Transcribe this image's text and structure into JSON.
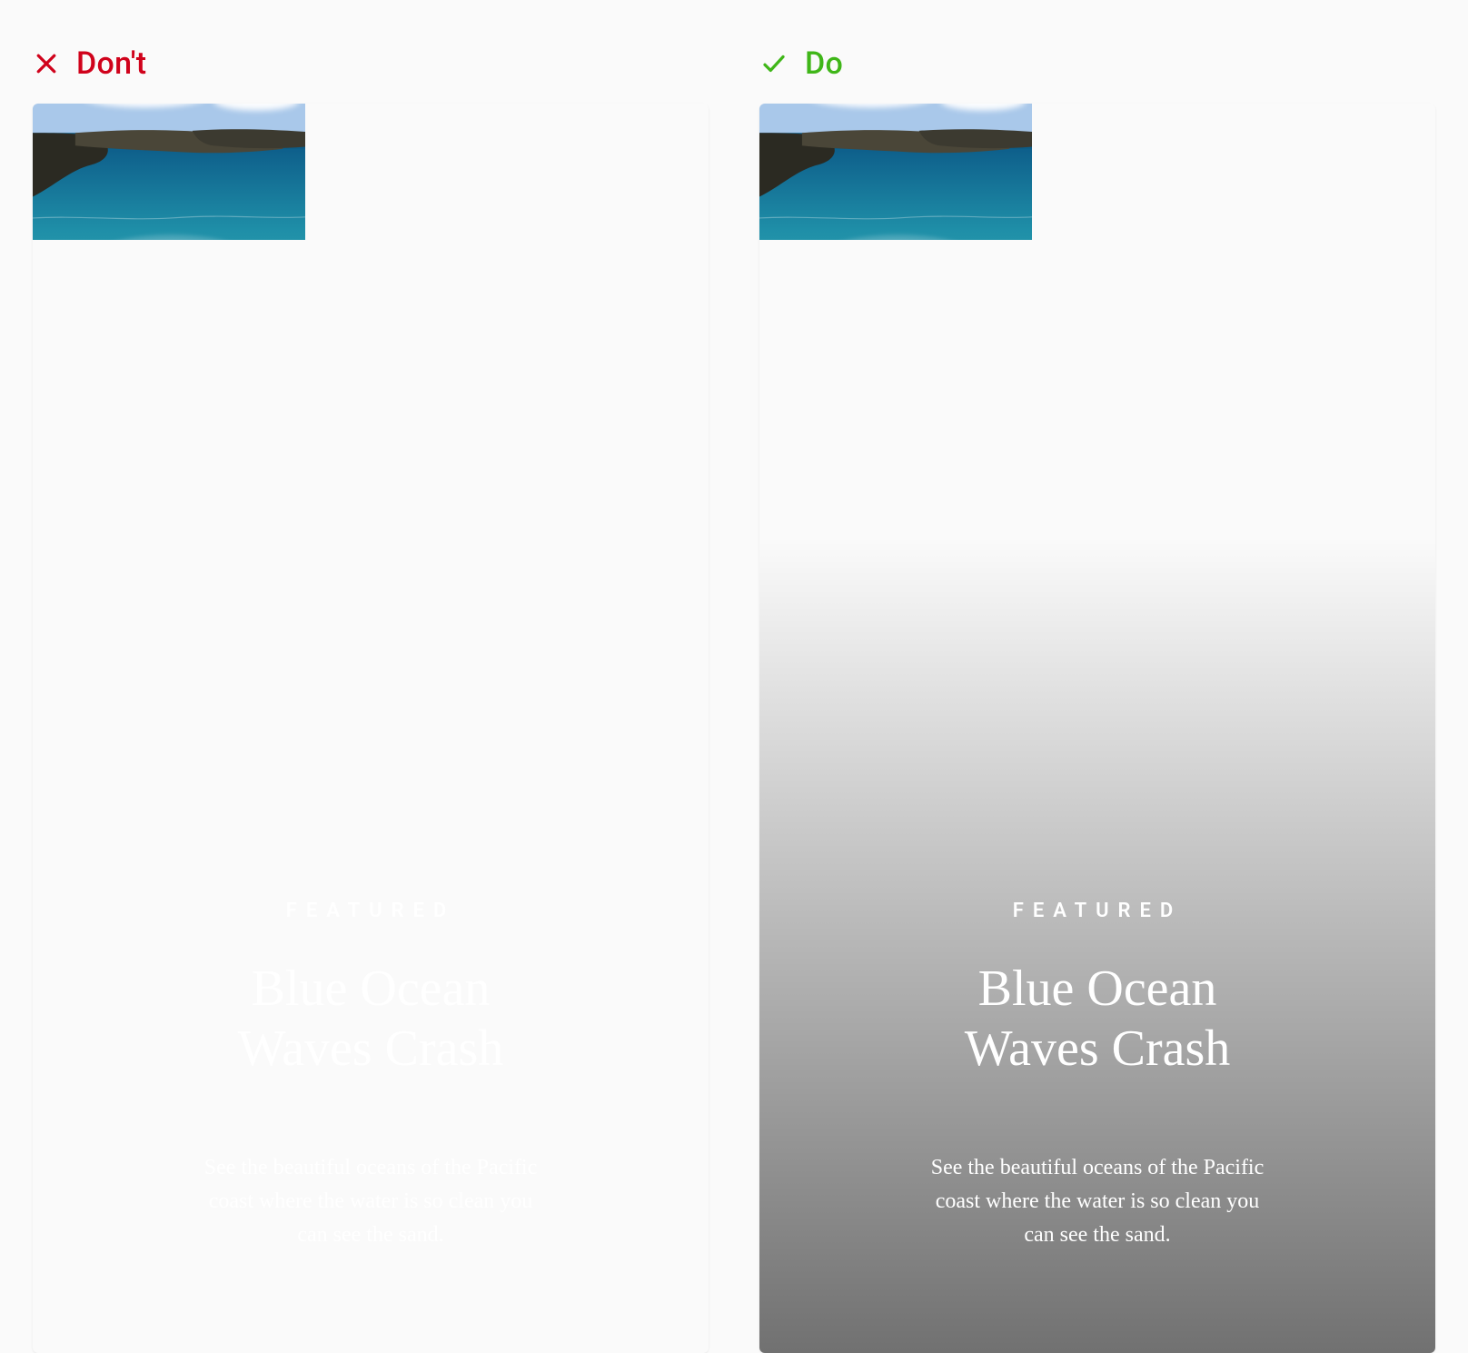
{
  "dont": {
    "label": "Don't",
    "card": {
      "eyebrow": "FEATURED",
      "title": "Blue Ocean Waves Crash",
      "description": "See the beautiful oceans of the Pacific coast where the water is so clean you can see the sand.",
      "has_contrast_overlay": false
    }
  },
  "do": {
    "label": "Do",
    "card": {
      "eyebrow": "FEATURED",
      "title": "Blue Ocean Waves Crash",
      "description": "See the beautiful oceans of the Pacific coast where the water is so clean you can see the sand.",
      "has_contrast_overlay": true
    }
  },
  "colors": {
    "dont": "#d0021b",
    "do": "#3fb618"
  }
}
